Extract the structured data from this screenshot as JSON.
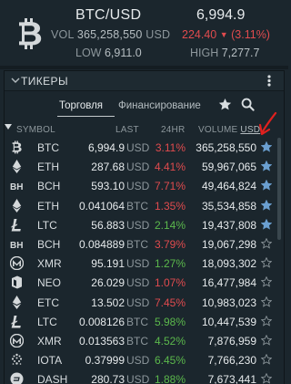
{
  "header": {
    "pair": "BTC/USD",
    "price": "6,994.9",
    "volume_label": "VOL",
    "volume_value": "365,258,550",
    "volume_unit": "USD",
    "change_value": "224.40",
    "change_percent": "(3.11%)",
    "low_label": "LOW",
    "low_value": "6,911.0",
    "high_label": "HIGH",
    "high_value": "7,277.7",
    "logo_icon": "bitcoin-logo-icon"
  },
  "panel": {
    "title": "ТИКЕРЫ",
    "tabs": [
      "Торговля",
      "Финансирование"
    ],
    "columns": {
      "symbol": "SYMBOL",
      "last": "LAST",
      "change": "24HR",
      "volume": "VOLUME",
      "volume_unit": "USD"
    },
    "rows": [
      {
        "icon": "btc-icon",
        "symbol": "BTC",
        "last": "6,994.9",
        "currency": "USD",
        "change": "3.11%",
        "dir": "dn",
        "volume": "365,258,550",
        "fav": true
      },
      {
        "icon": "eth-icon",
        "symbol": "ETH",
        "last": "287.68",
        "currency": "USD",
        "change": "4.41%",
        "dir": "dn",
        "volume": "59,967,065",
        "fav": true
      },
      {
        "icon": "bch-icon",
        "symbol": "BCH",
        "last": "593.10",
        "currency": "USD",
        "change": "7.71%",
        "dir": "dn",
        "volume": "49,464,824",
        "fav": true
      },
      {
        "icon": "eth-icon",
        "symbol": "ETH",
        "last": "0.041064",
        "currency": "BTC",
        "change": "1.35%",
        "dir": "dn",
        "volume": "35,534,858",
        "fav": true
      },
      {
        "icon": "ltc-icon",
        "symbol": "LTC",
        "last": "56.883",
        "currency": "USD",
        "change": "2.14%",
        "dir": "up",
        "volume": "19,437,808",
        "fav": true
      },
      {
        "icon": "bch-icon",
        "symbol": "BCH",
        "last": "0.084889",
        "currency": "BTC",
        "change": "3.79%",
        "dir": "dn",
        "volume": "19,067,298",
        "fav": false
      },
      {
        "icon": "xmr-icon",
        "symbol": "XMR",
        "last": "95.191",
        "currency": "USD",
        "change": "1.27%",
        "dir": "up",
        "volume": "18,093,302",
        "fav": false
      },
      {
        "icon": "neo-icon",
        "symbol": "NEO",
        "last": "26.029",
        "currency": "USD",
        "change": "1.07%",
        "dir": "dn",
        "volume": "16,477,984",
        "fav": false
      },
      {
        "icon": "etc-icon",
        "symbol": "ETC",
        "last": "13.502",
        "currency": "USD",
        "change": "7.45%",
        "dir": "dn",
        "volume": "10,983,023",
        "fav": false
      },
      {
        "icon": "ltc-icon",
        "symbol": "LTC",
        "last": "0.008126",
        "currency": "BTC",
        "change": "5.98%",
        "dir": "up",
        "volume": "10,447,539",
        "fav": false
      },
      {
        "icon": "xmr-icon",
        "symbol": "XMR",
        "last": "0.013563",
        "currency": "BTC",
        "change": "4.52%",
        "dir": "up",
        "volume": "7,876,959",
        "fav": false
      },
      {
        "icon": "iota-icon",
        "symbol": "IOTA",
        "last": "0.37999",
        "currency": "USD",
        "change": "6.45%",
        "dir": "up",
        "volume": "7,766,230",
        "fav": false
      },
      {
        "icon": "dash-icon",
        "symbol": "DASH",
        "last": "280.73",
        "currency": "USD",
        "change": "1.88%",
        "dir": "up",
        "volume": "7,673,441",
        "fav": false
      }
    ]
  },
  "colors": {
    "up": "#5bb84c",
    "down": "#e04b4e",
    "star_active": "#6a9fd0",
    "annotation": "#e0201e"
  }
}
